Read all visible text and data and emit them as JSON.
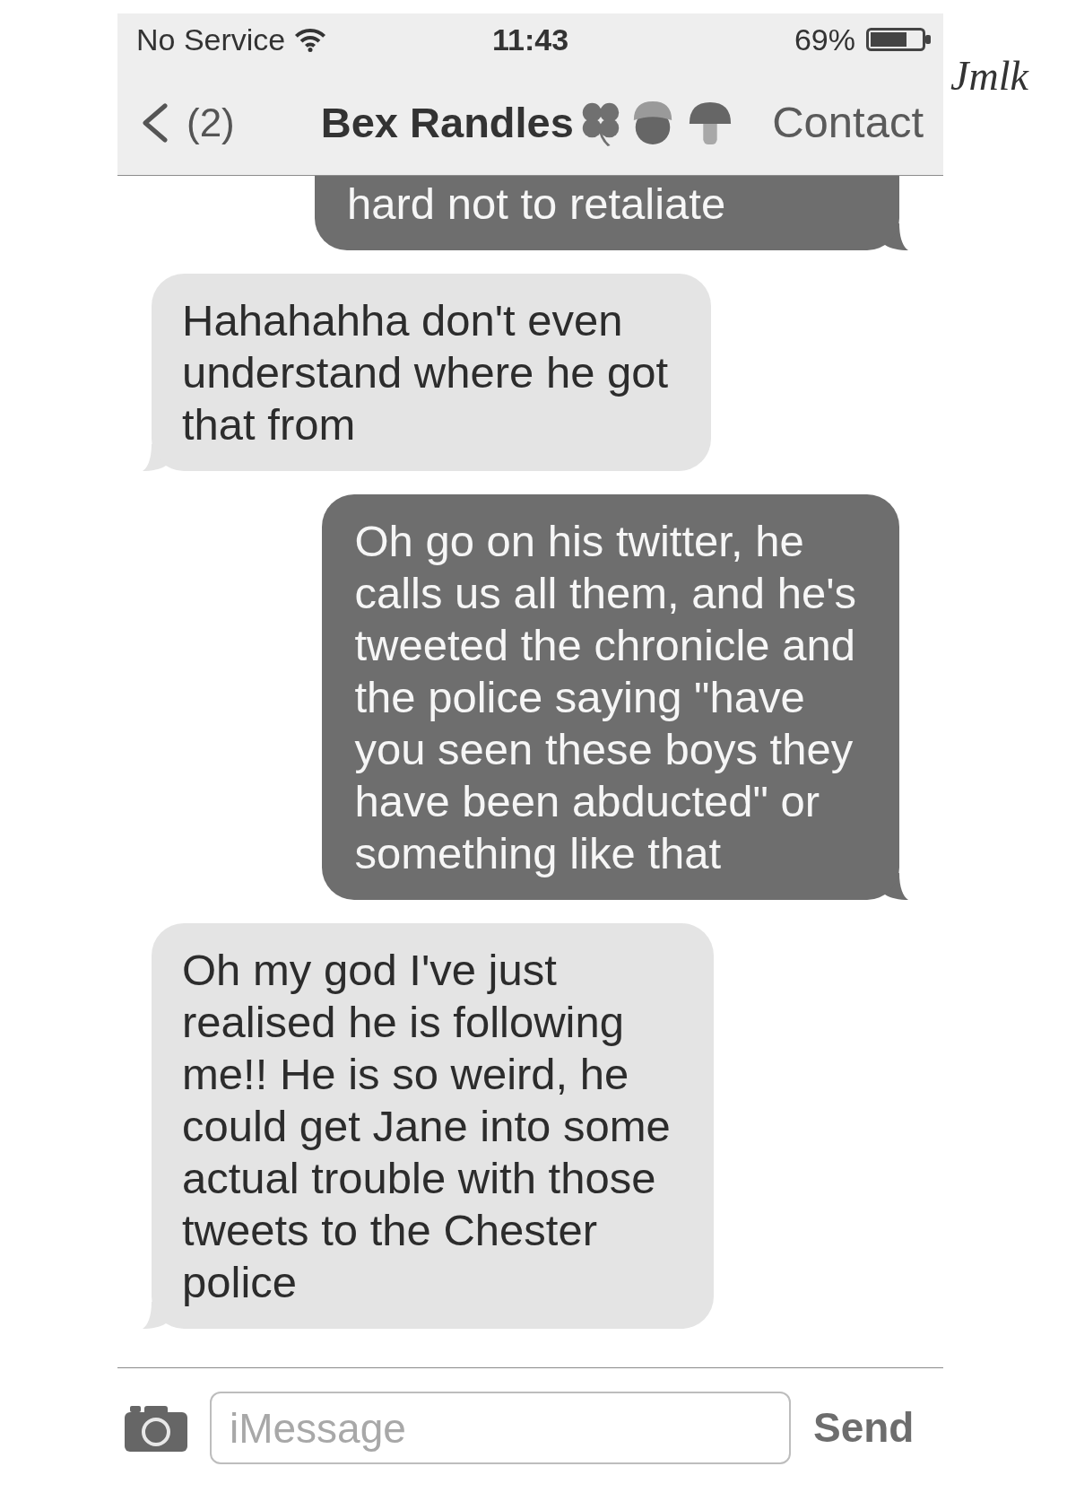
{
  "status_bar": {
    "carrier": "No Service",
    "time": "11:43",
    "battery": "69%"
  },
  "annotation": {
    "text": "Jmlk"
  },
  "nav_bar": {
    "back_count": "(2)",
    "title": "Bex Randles",
    "action": "Contact"
  },
  "messages": [
    {
      "kind": "sent",
      "partial": true,
      "lines": [
        "hard not to retaliate"
      ]
    },
    {
      "kind": "received",
      "partial": false,
      "lines": [
        "Hahahahha don't even",
        "understand where he got",
        "that from"
      ]
    },
    {
      "kind": "sent",
      "partial": false,
      "lines": [
        "Oh go on his twitter, he",
        "calls us all them, and he's",
        "tweeted the chronicle and",
        "the police saying \"have",
        "you seen these boys they",
        "have been abducted\" or",
        "something like that"
      ]
    },
    {
      "kind": "received",
      "partial": false,
      "lines": [
        "Oh my god I've just",
        "realised he is following",
        "me!! He is so weird, he",
        "could get Jane into some",
        "actual trouble with those",
        "tweets to the Chester",
        "police"
      ]
    }
  ],
  "composer": {
    "placeholder": "iMessage",
    "send": "Send"
  }
}
